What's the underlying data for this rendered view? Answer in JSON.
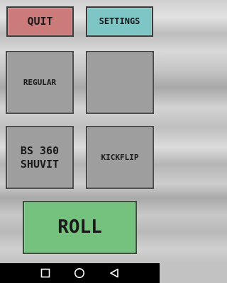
{
  "header": {
    "quit_label": "QUIT",
    "settings_label": "SETTINGS"
  },
  "tricks": {
    "slot1": {
      "line1": "REGULAR",
      "line2": ""
    },
    "slot2": {
      "line1": "",
      "line2": ""
    },
    "slot3": {
      "line1": "BS 360",
      "line2": "SHUVIT"
    },
    "slot4": {
      "line1": "KICKFLIP",
      "line2": ""
    }
  },
  "roll_label": "ROLL",
  "navbar": {
    "items": [
      "square-icon",
      "circle-icon",
      "triangle-back-icon"
    ]
  },
  "colors": {
    "quit": "#cc7b7b",
    "settings": "#7ec6c6",
    "trick_slot": "#9e9e9e",
    "roll": "#74c27d"
  }
}
